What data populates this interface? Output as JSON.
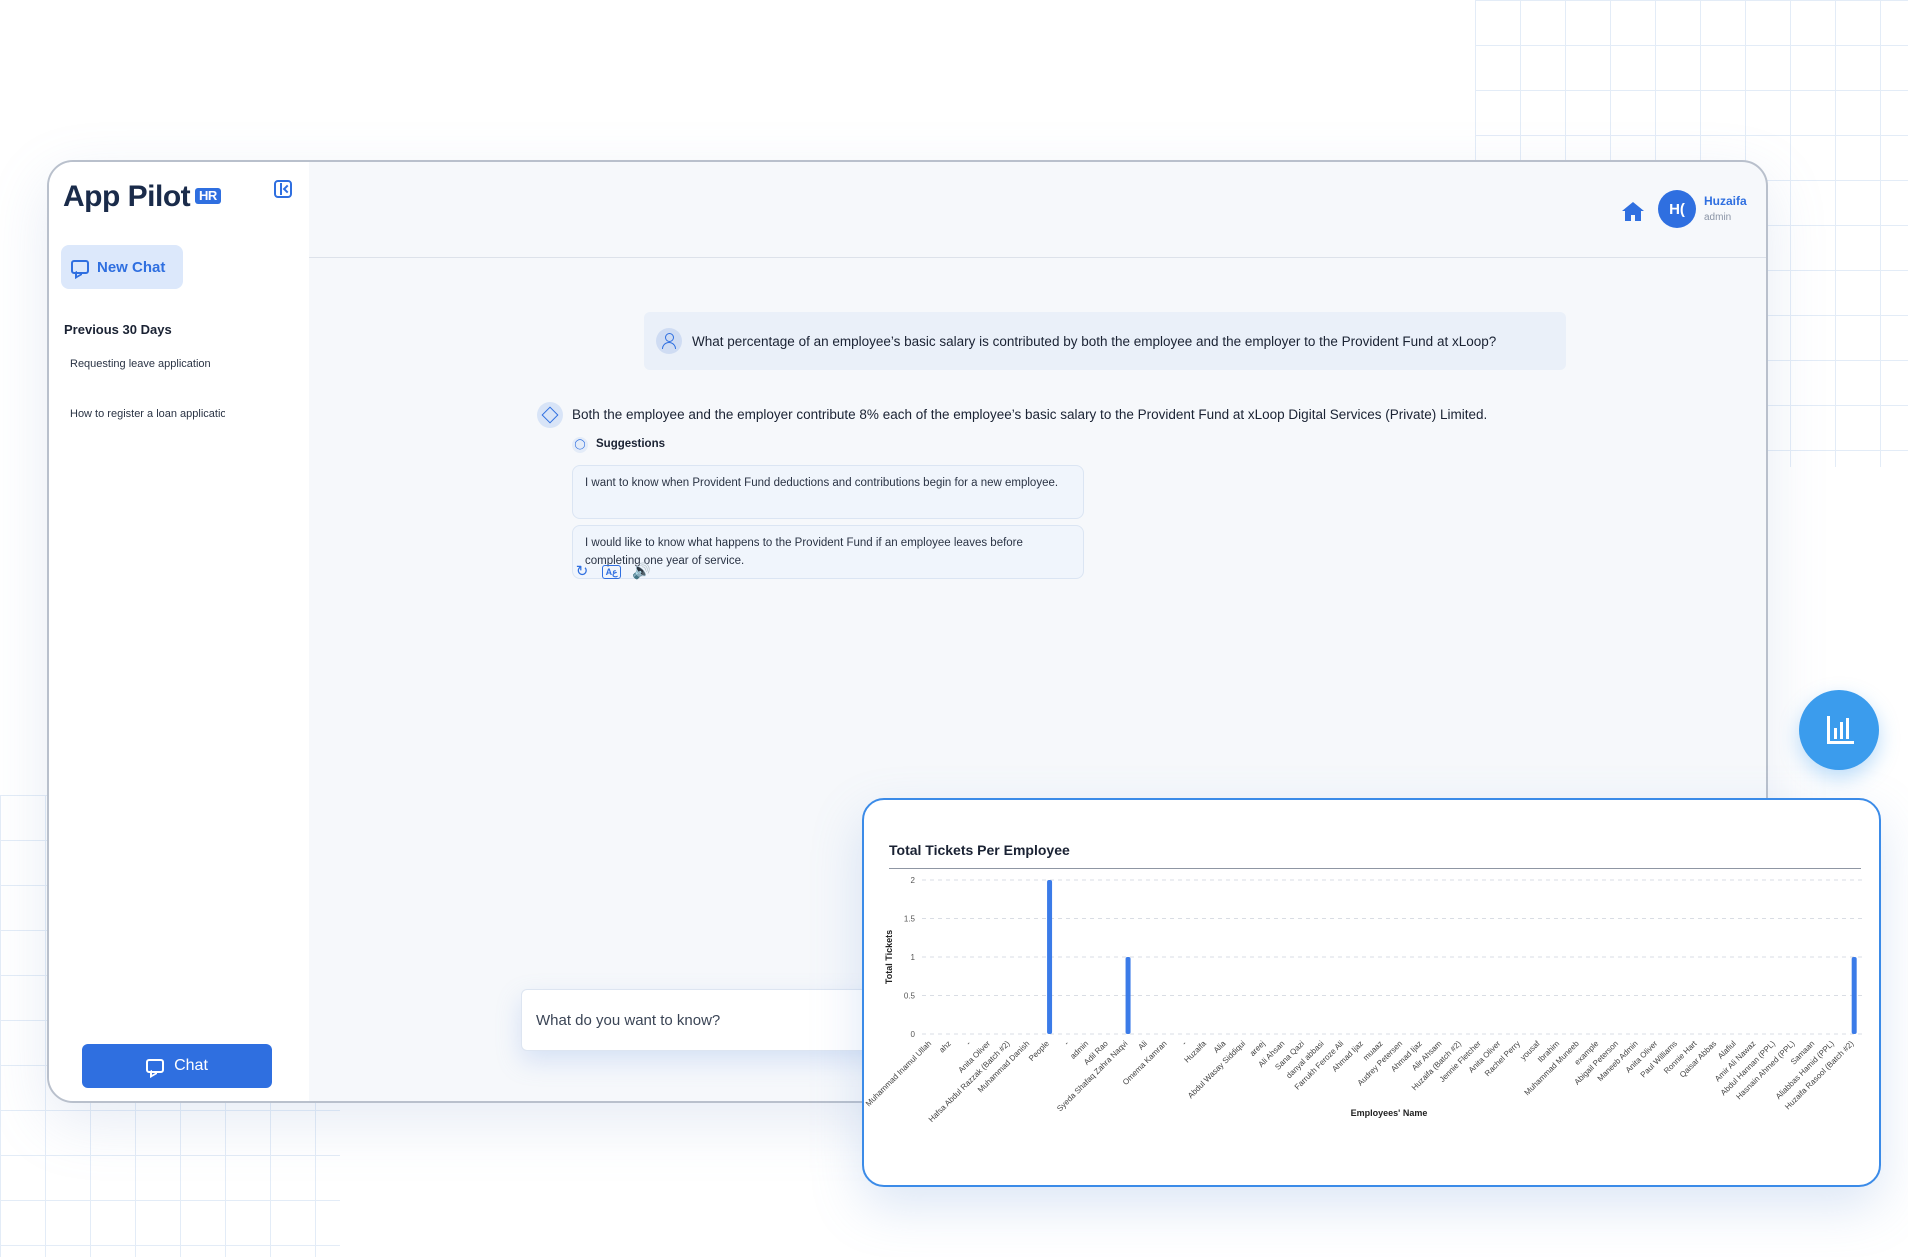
{
  "app": {
    "logo_text": "App Pilot",
    "logo_badge": "HR"
  },
  "sidebar": {
    "new_chat_label": "New Chat",
    "section_title": "Previous 30 Days",
    "history": [
      "Requesting leave application",
      "How to register a loan application"
    ],
    "chat_button_label": "Chat"
  },
  "header": {
    "user_initials": "H(",
    "user_name": "Huzaifa",
    "user_role": "admin"
  },
  "conversation": {
    "user_message": "What percentage of an employee’s basic salary is contributed by both the employee and the employer to the Provident Fund at xLoop?",
    "bot_message": "Both the employee and the employer contribute 8% each of the employee’s basic salary to the Provident Fund at xLoop Digital Services (Private) Limited.",
    "suggestions_label": "Suggestions",
    "suggestions": [
      "I want to know when Provident Fund deductions and contributions begin for a new employee.",
      "I would like to know what happens to the Provident Fund if an employee leaves before completing one year of service."
    ]
  },
  "input": {
    "placeholder": "What do you want to know?"
  },
  "colors": {
    "accent": "#2f6fe0",
    "bar": "#3b7be8",
    "fab": "#3b9ced"
  },
  "icons": [
    "collapse-sidebar-icon",
    "chat-icon",
    "home-icon",
    "user-icon",
    "bot-icon",
    "lightbulb-icon",
    "regenerate-icon",
    "translate-icon",
    "speaker-icon",
    "bar-chart-icon"
  ],
  "chart_data": {
    "type": "bar",
    "title": "Total Tickets Per Employee",
    "xlabel": "Employees' Name",
    "ylabel": "Total Tickets",
    "ylim": [
      0,
      2
    ],
    "yticks": [
      0,
      0.5,
      1,
      1.5,
      2
    ],
    "grid": true,
    "categories": [
      "Muhammad Inamul Ullah",
      "ahz",
      "-",
      "Anita Oliver",
      "Hafsa Abdul Razzak (Batch #2)",
      "Muhammad Danish",
      "People",
      "-",
      "admin",
      "Adil Rao",
      "Syeda Shafaq Zahra Naqvi",
      "Ali",
      "Omema Kamran",
      "-",
      "Huzaifa",
      "Alia",
      "Abdul Wasay Siddiqui",
      "areej",
      "Ali Ahsan",
      "Sana Qazi",
      "danyal abbasi",
      "Farrukh Feroze Ali",
      "Ahmad Ijaz",
      "muaaz",
      "Audrey Petersen",
      "Ahmad Ijaz",
      "Alir Ahsam",
      "Huzaifa (Batch #2)",
      "Jennie Fletcher",
      "Anita Oliver",
      "Rachel Perry",
      "yousaf",
      "Ibrahim",
      "Muhammad Muneeb",
      "example",
      "Abigail Peterson",
      "Maneeb Admin",
      "Anita Oliver",
      "Paul Williams",
      "Ronnie Hart",
      "Qaisar Abbas",
      "Alafiul",
      "Amir Ali Nawaz",
      "Abdul Hannan (PPL)",
      "Hasnain Ahmed (PPL)",
      "Samaan",
      "Aliabbas Hamid (PPL)",
      "Huzaifa Rasool (Batch #2)"
    ],
    "values": [
      0,
      0,
      0,
      0,
      0,
      0,
      2,
      0,
      0,
      0,
      1,
      0,
      0,
      0,
      0,
      0,
      0,
      0,
      0,
      0,
      0,
      0,
      0,
      0,
      0,
      0,
      0,
      0,
      0,
      0,
      0,
      0,
      0,
      0,
      0,
      0,
      0,
      0,
      0,
      0,
      0,
      0,
      0,
      0,
      0,
      0,
      0,
      1
    ]
  }
}
